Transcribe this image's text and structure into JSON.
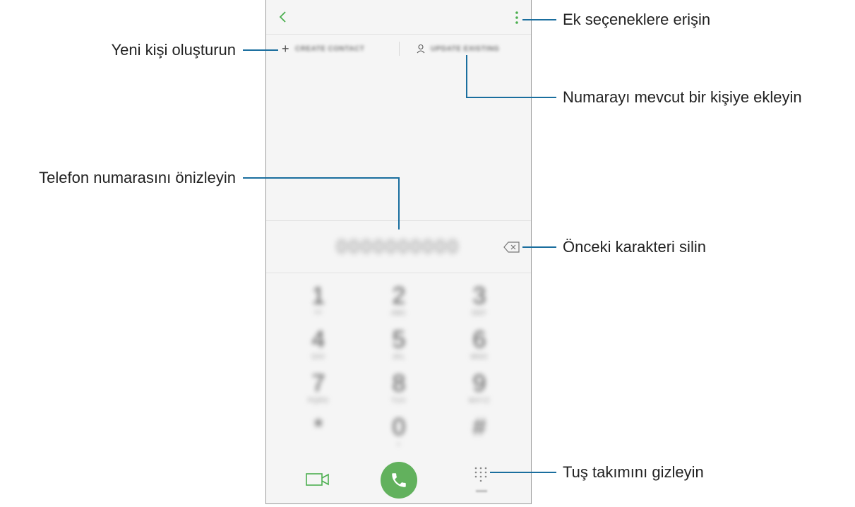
{
  "callouts": {
    "more_options": "Ek seçeneklere erişin",
    "create_contact": "Yeni kişi oluşturun",
    "add_to_existing": "Numarayı mevcut bir kişiye ekleyin",
    "preview_number": "Telefon numarasını önizleyin",
    "delete_char": "Önceki karakteri silin",
    "hide_keypad": "Tuş takımını gizleyin"
  },
  "phone": {
    "actions": {
      "create_label": "CREATE CONTACT",
      "update_label": "UPDATE EXISTING"
    },
    "number_preview": "0000000000",
    "keys": [
      {
        "digit": "1",
        "sub": "ᴼᴼ"
      },
      {
        "digit": "2",
        "sub": "ABC"
      },
      {
        "digit": "3",
        "sub": "DEF"
      },
      {
        "digit": "4",
        "sub": "GHI"
      },
      {
        "digit": "5",
        "sub": "JKL"
      },
      {
        "digit": "6",
        "sub": "MNO"
      },
      {
        "digit": "7",
        "sub": "PQRS"
      },
      {
        "digit": "8",
        "sub": "TUV"
      },
      {
        "digit": "9",
        "sub": "WXYZ"
      },
      {
        "digit": "*",
        "sub": ""
      },
      {
        "digit": "0",
        "sub": "+"
      },
      {
        "digit": "#",
        "sub": ""
      }
    ]
  },
  "colors": {
    "callout_line": "#1a6e9e",
    "accent_green": "#62b15d"
  }
}
